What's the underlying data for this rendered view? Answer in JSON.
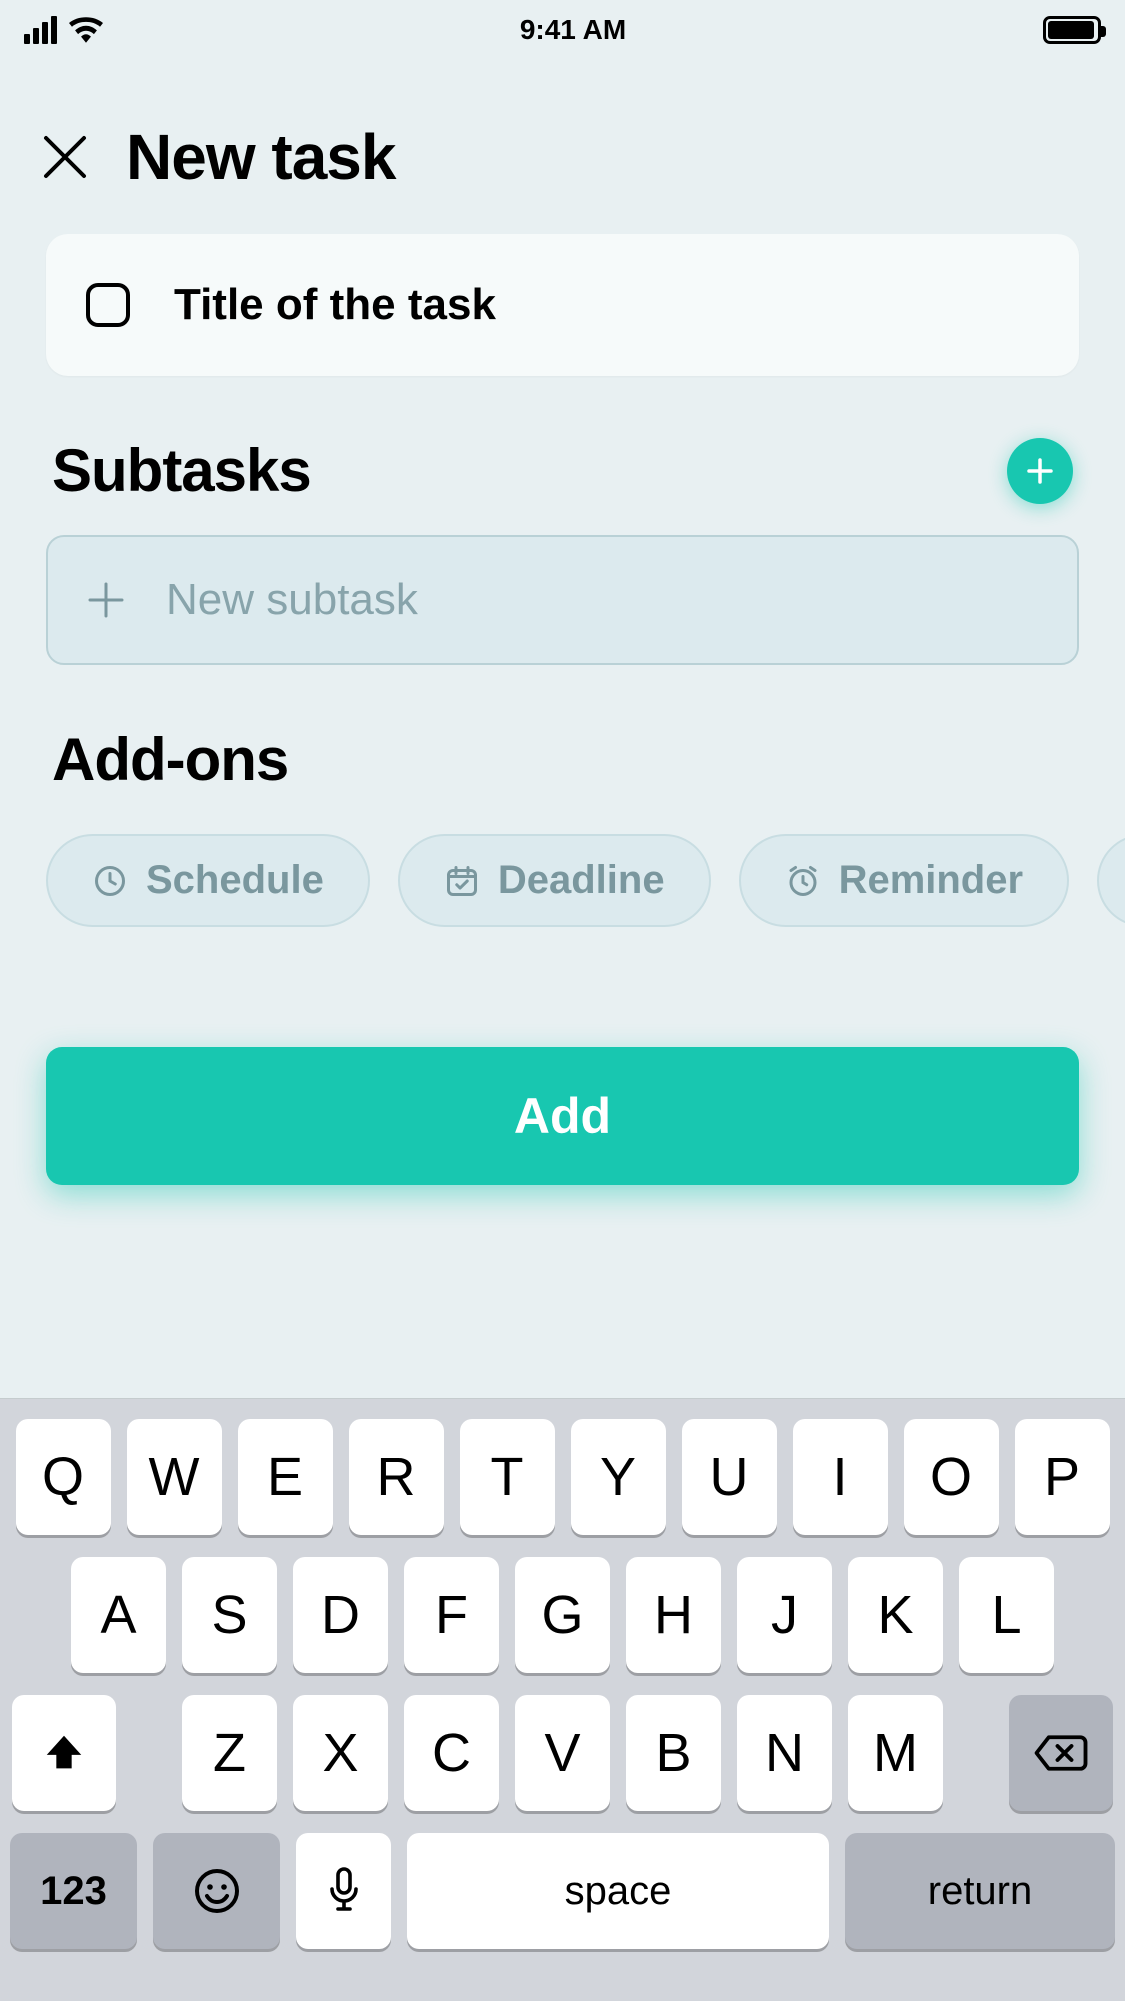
{
  "status_bar": {
    "time": "9:41 AM"
  },
  "header": {
    "title": "New task"
  },
  "task": {
    "title_placeholder": "Title of the task",
    "title_value": ""
  },
  "subtasks": {
    "section_title": "Subtasks",
    "new_placeholder": "New subtask"
  },
  "addons": {
    "section_title": "Add-ons",
    "chips": [
      {
        "icon": "clock-icon",
        "label": "Schedule"
      },
      {
        "icon": "calendar-check-icon",
        "label": "Deadline"
      },
      {
        "icon": "alarm-icon",
        "label": "Reminder"
      }
    ]
  },
  "primary_button": {
    "label": "Add"
  },
  "keyboard": {
    "row1": [
      "Q",
      "W",
      "E",
      "R",
      "T",
      "Y",
      "U",
      "I",
      "O",
      "P"
    ],
    "row2": [
      "A",
      "S",
      "D",
      "F",
      "G",
      "H",
      "J",
      "K",
      "L"
    ],
    "row3": [
      "Z",
      "X",
      "C",
      "V",
      "B",
      "N",
      "M"
    ],
    "numkey": "123",
    "space": "space",
    "return": "return"
  },
  "colors": {
    "accent": "#18c7b0",
    "muted_text": "#7a979e"
  }
}
